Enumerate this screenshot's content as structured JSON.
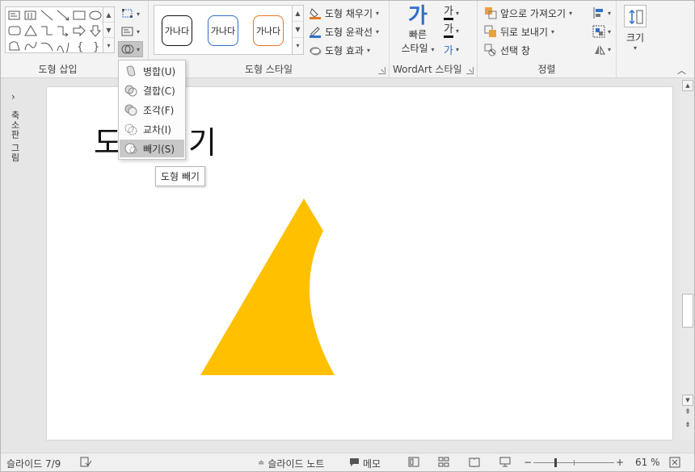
{
  "ribbon": {
    "groups": {
      "insert_shapes": "도형 삽입",
      "shape_styles": "도형 스타일",
      "wordart_styles": "WordArt 스타일",
      "arrange": "정렬",
      "size": "크기"
    },
    "style_presets": [
      "가나다",
      "가나다",
      "가나다"
    ],
    "shape_fill": "도형 채우기",
    "shape_outline": "도형 윤곽선",
    "shape_effects": "도형 효과",
    "quick_styles": "빠른\n스타일",
    "quick_styles_line1": "빠른",
    "quick_styles_line2": "스타일",
    "wordart_text_glyph": "가",
    "bring_forward": "앞으로 가져오기",
    "send_backward": "뒤로 보내기",
    "selection_pane": "선택 창",
    "size_button": "크기"
  },
  "merge_menu": {
    "items": [
      {
        "label": "병합(U)",
        "icon": "union-icon"
      },
      {
        "label": "결합(C)",
        "icon": "combine-icon"
      },
      {
        "label": "조각(F)",
        "icon": "fragment-icon"
      },
      {
        "label": "교차(I)",
        "icon": "intersect-icon"
      },
      {
        "label": "빼기(S)",
        "icon": "subtract-icon",
        "highlighted": true
      }
    ],
    "tooltip": "도형 빼기"
  },
  "left_rail": {
    "label": "축소판 그림"
  },
  "slide": {
    "title": "도형 빼기",
    "shape_color": "#FFC000"
  },
  "status": {
    "slide_counter": "슬라이드 7/9",
    "notes": "슬라이드 노트",
    "comments": "메모",
    "zoom": "61 %"
  },
  "colors": {
    "fill_accent": "#E87722",
    "outline_accent": "#2F6FC9",
    "shape": "#FFC000"
  }
}
